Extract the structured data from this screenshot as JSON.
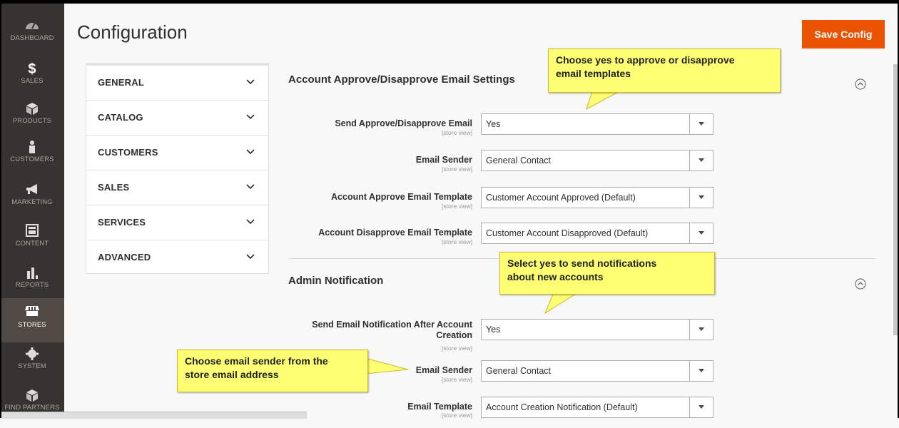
{
  "sidebar": {
    "items": [
      {
        "label": "DASHBOARD",
        "icon": "dashboard-icon"
      },
      {
        "label": "SALES",
        "icon": "dollar-icon"
      },
      {
        "label": "PRODUCTS",
        "icon": "box-icon"
      },
      {
        "label": "CUSTOMERS",
        "icon": "person-icon"
      },
      {
        "label": "MARKETING",
        "icon": "megaphone-icon"
      },
      {
        "label": "CONTENT",
        "icon": "layout-icon"
      },
      {
        "label": "REPORTS",
        "icon": "bar-chart-icon"
      },
      {
        "label": "STORES",
        "icon": "store-icon",
        "active": true
      },
      {
        "label": "SYSTEM",
        "icon": "gear-icon"
      },
      {
        "label": "FIND PARTNERS",
        "icon": "cube-icon"
      }
    ]
  },
  "header": {
    "title": "Configuration",
    "save_label": "Save Config"
  },
  "tabs": [
    {
      "label": "GENERAL"
    },
    {
      "label": "CATALOG"
    },
    {
      "label": "CUSTOMERS"
    },
    {
      "label": "SALES"
    },
    {
      "label": "SERVICES"
    },
    {
      "label": "ADVANCED"
    }
  ],
  "sections": {
    "approve": {
      "title": "Account Approve/Disapprove Email Settings",
      "rows": [
        {
          "label": "Send Approve/Disapprove Email",
          "scope": "[store view]",
          "value": "Yes"
        },
        {
          "label": "Email Sender",
          "scope": "[store view]",
          "value": "General Contact"
        },
        {
          "label": "Account Approve Email Template",
          "scope": "[store view]",
          "value": "Customer Account Approved (Default)"
        },
        {
          "label": "Account Disapprove Email Template",
          "scope": "[store view]",
          "value": "Customer Account Disapproved (Default)"
        }
      ]
    },
    "admin": {
      "title": "Admin Notification",
      "rows": [
        {
          "label_line1": "Send Email Notification After Account",
          "label_line2": "Creation",
          "scope": "[store view]",
          "value": "Yes"
        },
        {
          "label": "Email Sender",
          "scope": "[store view]",
          "value": "General Contact"
        },
        {
          "label": "Email Template",
          "scope": "[store view]",
          "value": "Account Creation Notification (Default)"
        }
      ]
    }
  },
  "callouts": {
    "approve": {
      "line1": "Choose yes to approve or disapprove",
      "line2": "email templates"
    },
    "notify": {
      "line1": "Select yes to send notifications",
      "line2": "about new accounts"
    },
    "sender": {
      "line1": "Choose email sender from the",
      "line2": "store email address"
    }
  },
  "colors": {
    "accent": "#eb5202",
    "sidebar": "#373330",
    "callout": "#ffff73"
  }
}
